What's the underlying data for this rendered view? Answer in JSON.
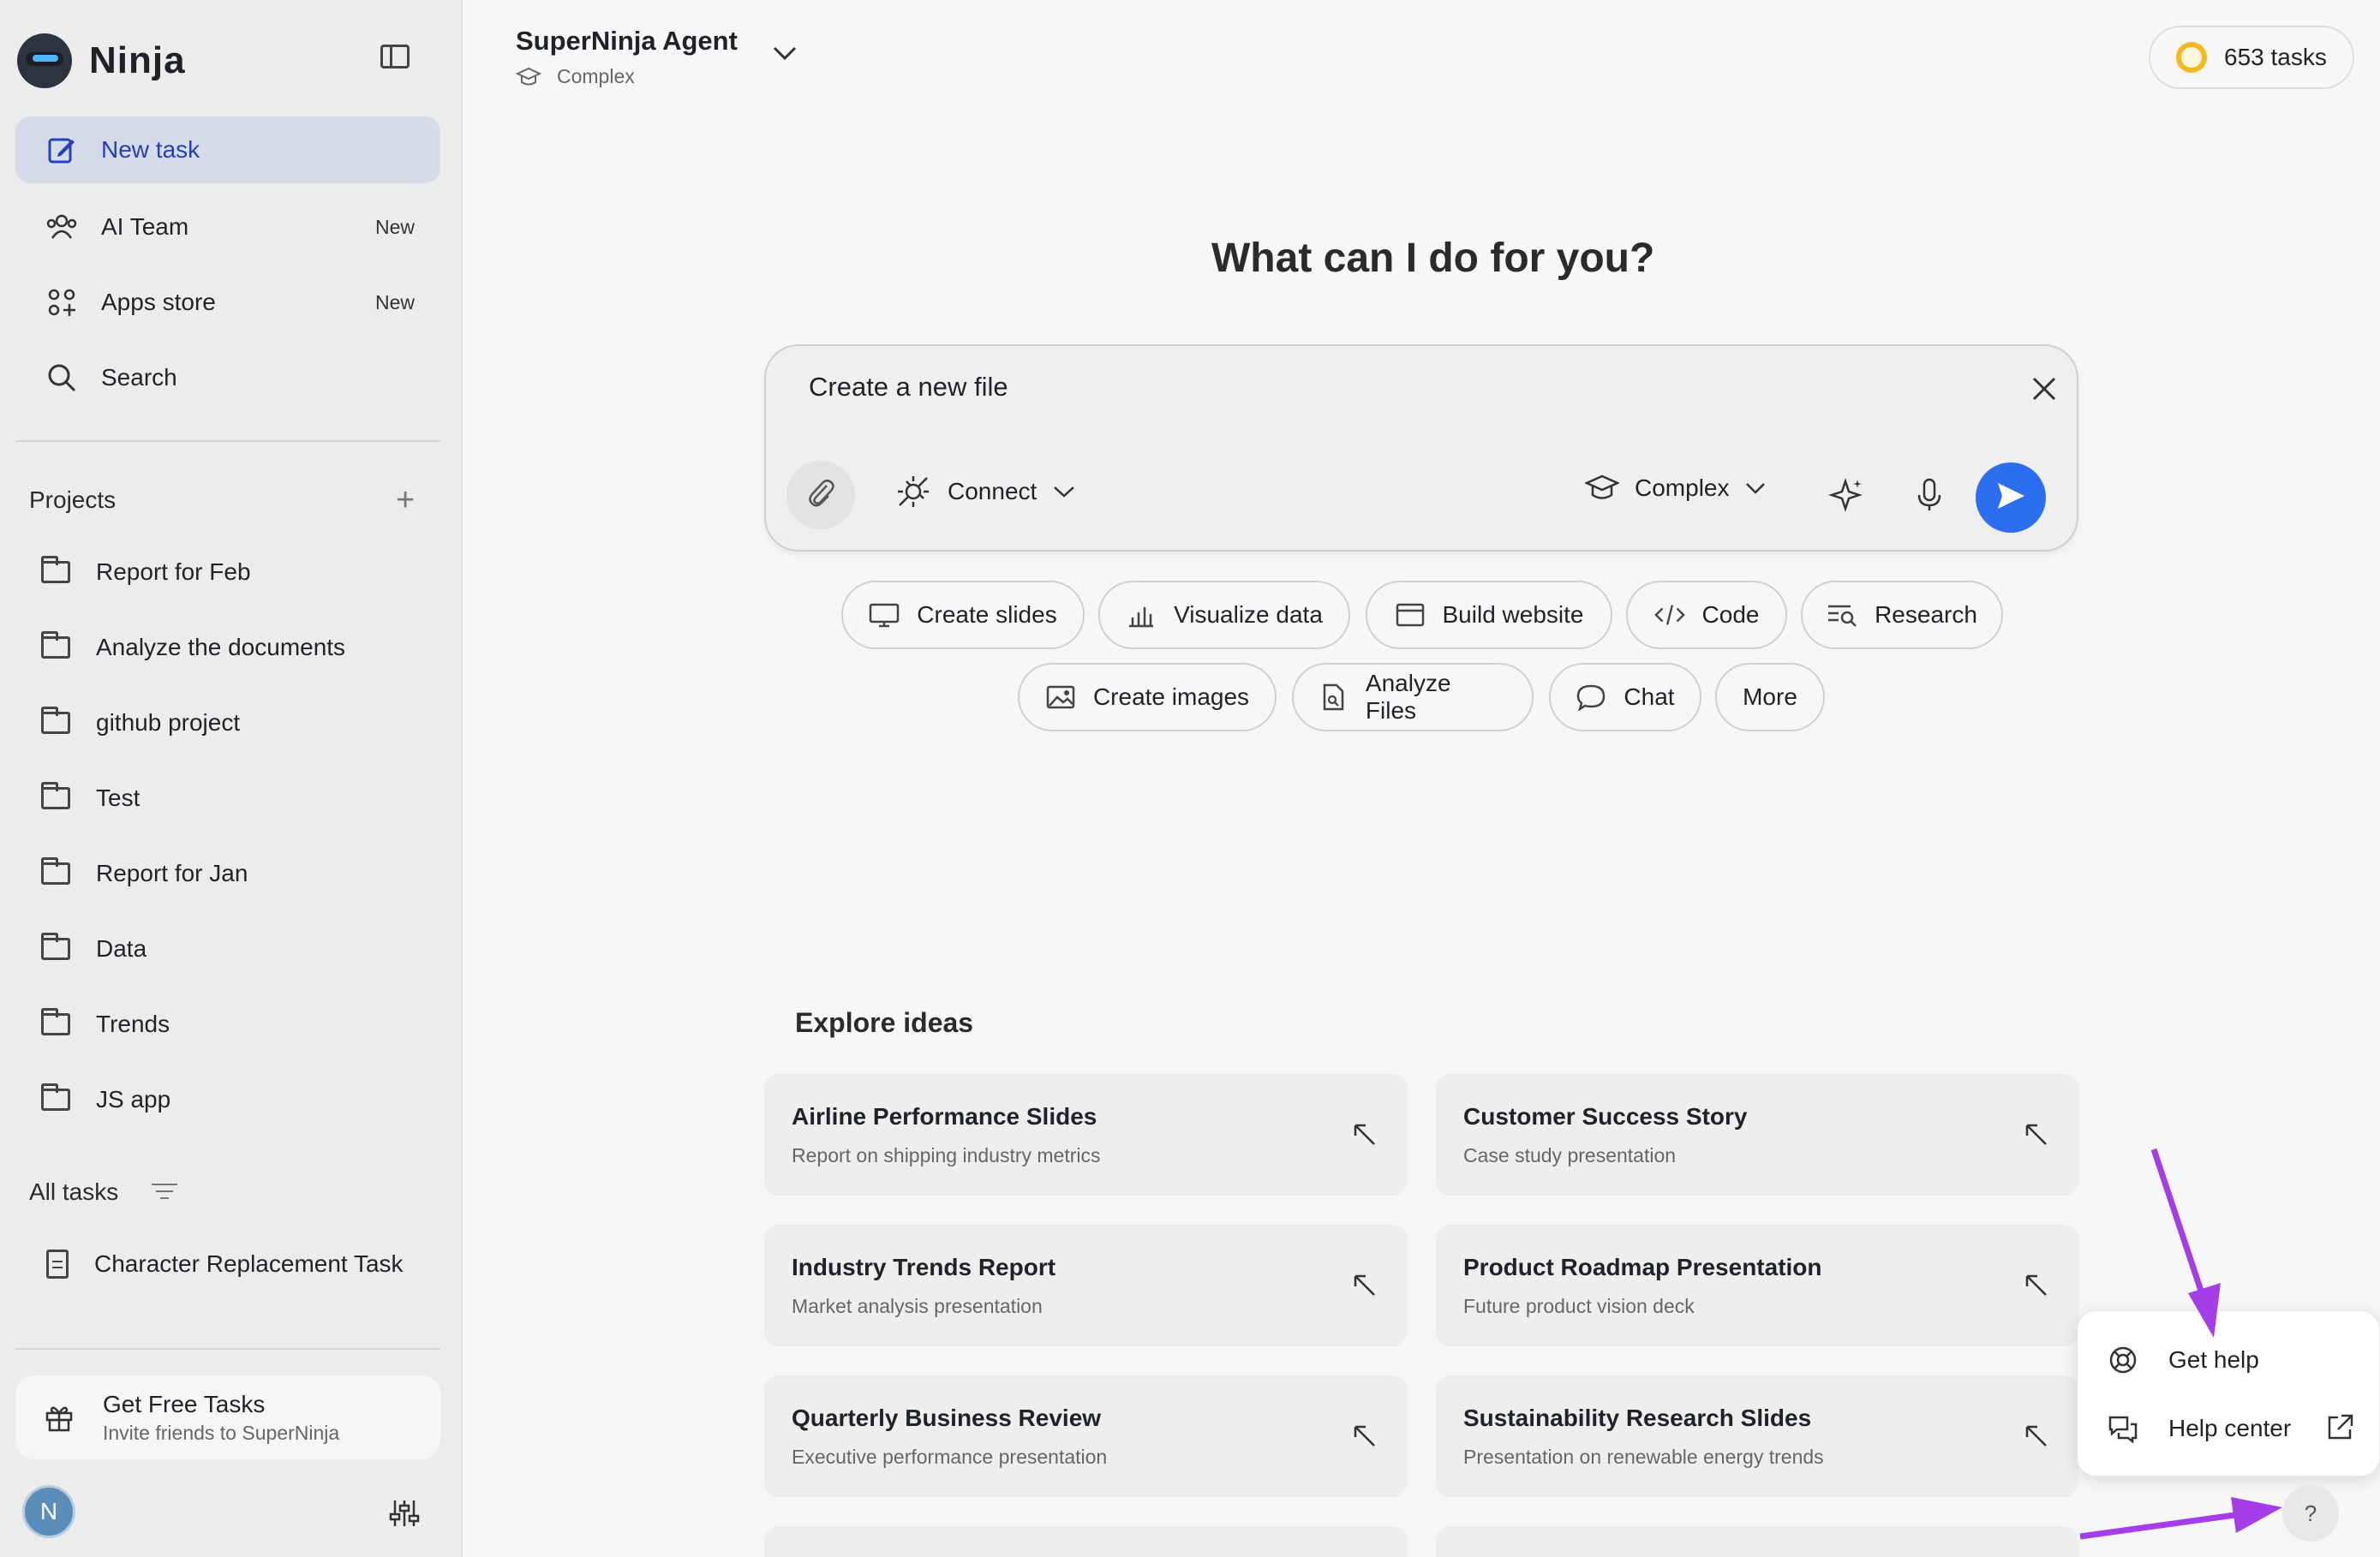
{
  "sidebar": {
    "brand": "Ninja",
    "nav": [
      {
        "label": "New task",
        "badge": ""
      },
      {
        "label": "AI Team",
        "badge": "New"
      },
      {
        "label": "Apps store",
        "badge": "New"
      },
      {
        "label": "Search",
        "badge": ""
      }
    ],
    "projects_heading": "Projects",
    "projects": [
      "Report for Feb",
      "Analyze the documents",
      "github project",
      "Test",
      "Report for Jan",
      "Data",
      "Trends",
      "JS app"
    ],
    "all_tasks_heading": "All tasks",
    "tasks": [
      "Character Replacement Task"
    ],
    "free_tasks": {
      "title": "Get Free Tasks",
      "subtitle": "Invite friends to SuperNinja"
    },
    "avatar_initial": "N"
  },
  "header": {
    "agent_name": "SuperNinja Agent",
    "agent_mode": "Complex",
    "tasks_count": "653 tasks"
  },
  "main": {
    "hero": "What can I do for you?",
    "prompt": {
      "value": "Create a new file",
      "connect_label": "Connect",
      "mode_label": "Complex"
    },
    "chips_row1": [
      "Create slides",
      "Visualize data",
      "Build website",
      "Code",
      "Research"
    ],
    "chips_row2": [
      "Create images",
      "Analyze Files",
      "Chat",
      "More"
    ],
    "explore_title": "Explore ideas",
    "ideas": [
      {
        "title": "Airline Performance Slides",
        "subtitle": "Report on shipping industry metrics"
      },
      {
        "title": "Customer Success Story",
        "subtitle": "Case study presentation"
      },
      {
        "title": "Industry Trends Report",
        "subtitle": "Market analysis presentation"
      },
      {
        "title": "Product Roadmap Presentation",
        "subtitle": "Future product vision deck"
      },
      {
        "title": "Quarterly Business Review",
        "subtitle": "Executive performance presentation"
      },
      {
        "title": "Sustainability Research Slides",
        "subtitle": "Presentation on renewable energy trends"
      }
    ]
  },
  "help": {
    "get_help": "Get help",
    "help_center": "Help center",
    "fab": "?"
  },
  "colors": {
    "accent": "#2b6ff0",
    "active_nav_bg": "#d6dbe9",
    "active_nav_text": "#2340b8",
    "coin": "#f4b920",
    "annotation_arrow": "#a43ee8"
  }
}
